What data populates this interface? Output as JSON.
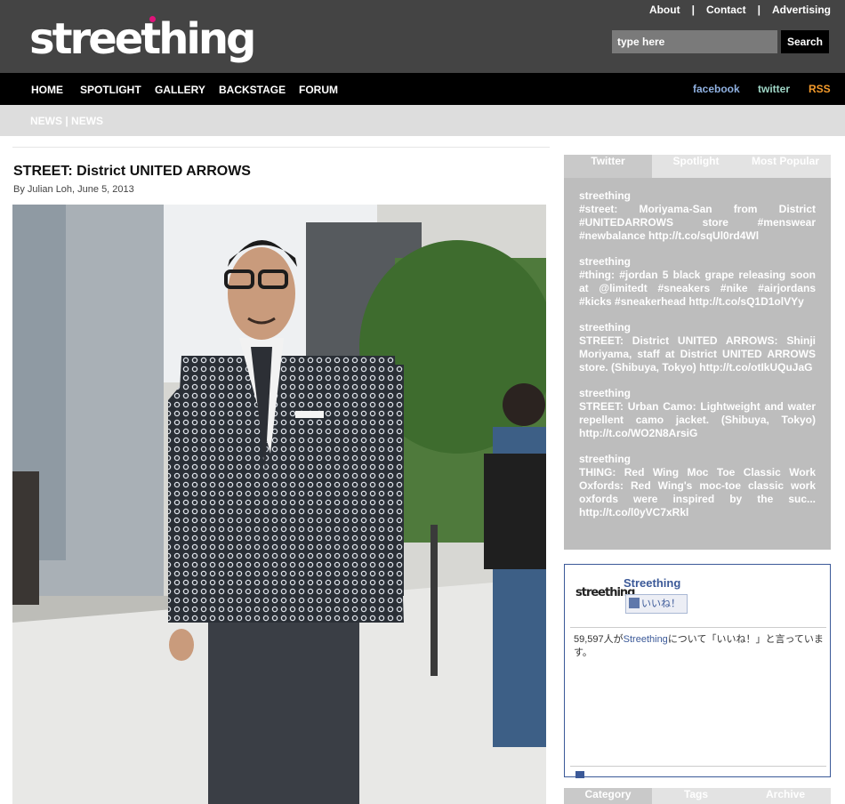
{
  "header": {
    "logo": "streething",
    "links": [
      "About",
      "Contact",
      "Advertising"
    ],
    "search_placeholder": "type here",
    "search_button": "Search"
  },
  "nav": {
    "items": [
      "HOME",
      "SPOTLIGHT",
      "GALLERY",
      "BACKSTAGE",
      "FORUM"
    ],
    "social": [
      {
        "label": "facebook",
        "color": "#8fb0e0"
      },
      {
        "label": "twitter",
        "color": "#9fd6c6"
      },
      {
        "label": "RSS",
        "color": "#f39a2b"
      }
    ]
  },
  "breadcrumb": "NEWS | NEWS",
  "article": {
    "title": "STREET: District UNITED ARROWS",
    "byline": "By Julian Loh, June 5, 2013"
  },
  "sidebar": {
    "tabs": [
      "Twitter",
      "Spotlight",
      "Most Popular"
    ],
    "tweets": [
      {
        "user": "streething",
        "text": "#street: Moriyama-San from District #UNITEDARROWS store #menswear #newbalance http://t.co/sqUl0rd4Wl"
      },
      {
        "user": "streething",
        "text": "#thing: #jordan 5 black grape releasing soon at @limitedt #sneakers #nike #airjordans #kicks #sneakerhead http://t.co/sQ1D1olVYy"
      },
      {
        "user": "streething",
        "text": "STREET: District UNITED ARROWS: Shinji Moriyama, staff at District UNITED ARROWS store. (Shibuya, Tokyo) http://t.co/otIkUQuJaG"
      },
      {
        "user": "streething",
        "text": "STREET: Urban Camo: Lightweight and water repellent camo jacket. (Shibuya, Tokyo) http://t.co/WO2N8ArsiG"
      },
      {
        "user": "streething",
        "text": "THING: Red Wing Moc Toe Classic Work Oxfords: Red Wing's moc-toe classic work oxfords were inspired by the suc... http://t.co/l0yVC7xRkl"
      }
    ],
    "facebook": {
      "logo": "streething",
      "name": "Streething",
      "like_button": "いいね！",
      "count_prefix": "59,597人が",
      "count_link": "Streething",
      "count_suffix": "について「いいね！」と言っています。"
    },
    "bottom_tabs": [
      "Category",
      "Tags",
      "Archive"
    ]
  },
  "colors": {
    "header_bg": "#444444",
    "nav_bg": "#000000",
    "subbar_bg": "#dddddd",
    "tab_active": "#c9c9c9",
    "tab_inactive": "#e3e3e3",
    "tweets_bg": "#bdbdbd",
    "logo_dot": "#e0137a"
  }
}
